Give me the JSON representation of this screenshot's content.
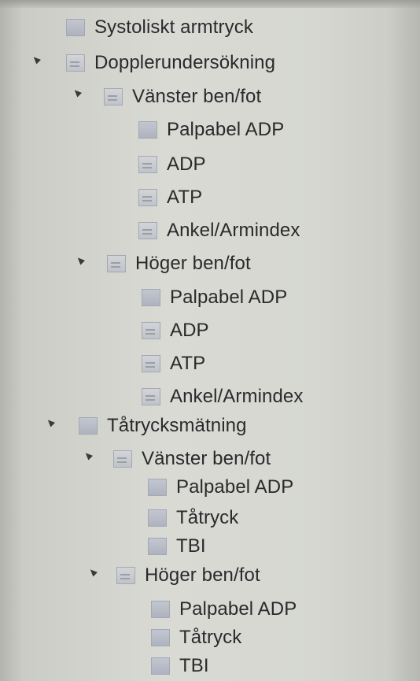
{
  "tree": {
    "items": [
      {
        "label": "Systoliskt armtryck",
        "icon": "folder-icon"
      },
      {
        "label": "Dopplerundersökning",
        "icon": "document-icon"
      },
      {
        "label": "Vänster ben/fot",
        "icon": "document-icon"
      },
      {
        "label": "Palpabel ADP",
        "icon": "folder-icon"
      },
      {
        "label": "ADP",
        "icon": "document-icon"
      },
      {
        "label": "ATP",
        "icon": "document-icon"
      },
      {
        "label": "Ankel/Armindex",
        "icon": "document-icon"
      },
      {
        "label": "Höger ben/fot",
        "icon": "document-icon"
      },
      {
        "label": "Palpabel ADP",
        "icon": "folder-icon"
      },
      {
        "label": "ADP",
        "icon": "document-icon"
      },
      {
        "label": "ATP",
        "icon": "document-icon"
      },
      {
        "label": "Ankel/Armindex",
        "icon": "document-icon"
      },
      {
        "label": "Tåtrycksmätning",
        "icon": "folder-icon"
      },
      {
        "label": "Vänster ben/fot",
        "icon": "document-icon"
      },
      {
        "label": "Palpabel ADP",
        "icon": "folder-icon"
      },
      {
        "label": "Tåtryck",
        "icon": "folder-icon"
      },
      {
        "label": "TBI",
        "icon": "folder-icon"
      },
      {
        "label": "Höger ben/fot",
        "icon": "document-icon"
      },
      {
        "label": "Palpabel ADP",
        "icon": "folder-icon"
      },
      {
        "label": "Tåtryck",
        "icon": "folder-icon"
      },
      {
        "label": "TBI",
        "icon": "folder-icon"
      }
    ]
  }
}
